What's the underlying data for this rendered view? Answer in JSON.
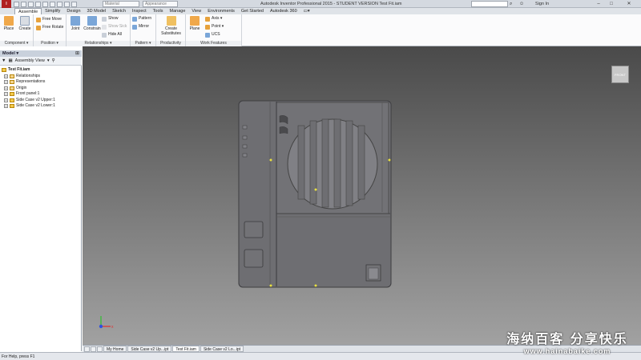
{
  "titlebar": {
    "app_letter": "I",
    "material_combo": "Material",
    "appearance_combo": "Appearance",
    "title": "Autodesk Inventor Professional 2015 - STUDENT VERSION    Test Fit.iam",
    "sign_in": "Sign In",
    "search_placeholder": ""
  },
  "ribbon_tabs": [
    "Assemble",
    "Simplify",
    "Design",
    "3D Model",
    "Sketch",
    "Inspect",
    "Tools",
    "Manage",
    "View",
    "Environments",
    "Get Started",
    "Autodesk 360"
  ],
  "active_tab": "Assemble",
  "ribbon": {
    "component": {
      "label": "Component ▾",
      "place": "Place",
      "create": "Create",
      "free_move": "Free Move",
      "free_rotate": "Free Rotate"
    },
    "position": {
      "label": "Position ▾"
    },
    "relationships": {
      "label": "Relationships ▾",
      "joint": "Joint",
      "constrain": "Constrain",
      "show": "Show",
      "show_sick": "Show Sick",
      "hide_all": "Hide All"
    },
    "pattern": {
      "label": "Pattern ▾",
      "pattern": "Pattern",
      "mirror": "Mirror"
    },
    "productivity": {
      "label": "Productivity",
      "create_substitutes": "Create Substitutes"
    },
    "work_features": {
      "label": "Work Features",
      "plane": "Plane",
      "axis": "Axis ▾",
      "point": "Point ▾",
      "ucs": "UCS"
    }
  },
  "browser": {
    "header": "Model ▾",
    "view": "Assembly View",
    "root": "Test Fit.iam",
    "items": [
      "Relationships",
      "Representations",
      "Origin",
      "Front panel:1",
      "Side Case v2 Upper:1",
      "Side Case v2 Lower:1"
    ]
  },
  "viewcube_label": "FRONT",
  "doc_tabs": [
    "My Home",
    "Side Case v2 Up...ipt",
    "Test Fit.iam",
    "Side Case v2 Lo...ipt"
  ],
  "active_doc": "Test Fit.iam",
  "status": "For Help, press F1",
  "watermark": {
    "line1": "海纳百客 分享快乐",
    "line2": "www.hainabaike.com"
  },
  "colors": {
    "accent": "#2a6bbf",
    "viewport_top": "#4a4a4a",
    "viewport_bottom": "#a3a3a3",
    "model_gray": "#6e6e72"
  }
}
